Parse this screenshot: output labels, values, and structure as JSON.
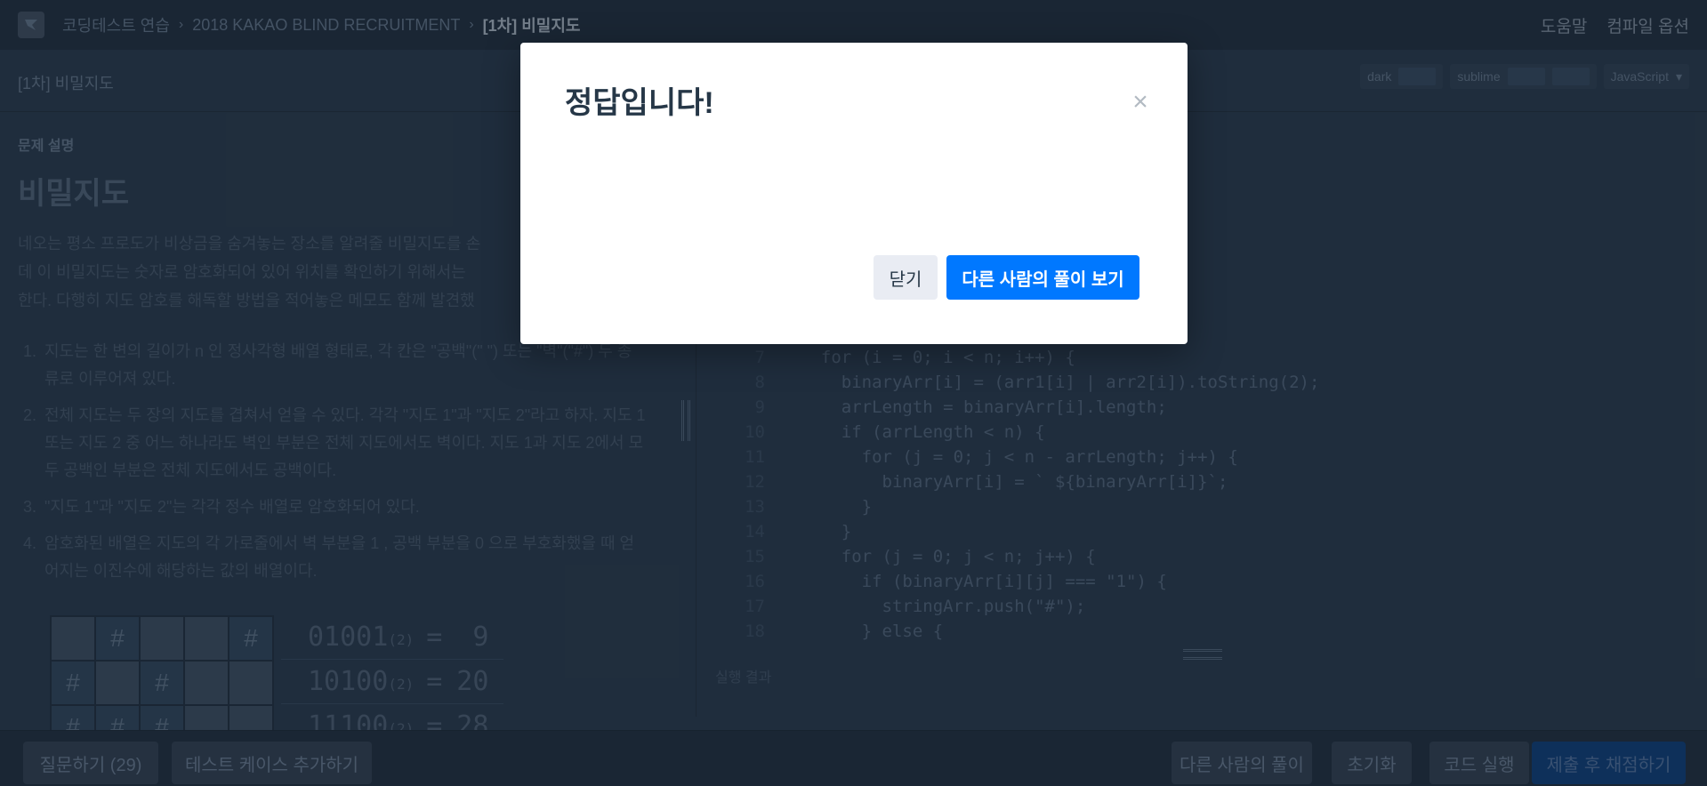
{
  "breadcrumb": {
    "items": [
      "코딩테스트 연습",
      "2018 KAKAO BLIND RECRUITMENT"
    ],
    "current": "[1차] 비밀지도"
  },
  "topnav": {
    "help": "도움말",
    "compile_options": "컴파일 옵션"
  },
  "header": {
    "problem_title": "[1차] 비밀지도",
    "theme_dark": "dark",
    "theme_sublime": "sublime",
    "language": "JavaScript"
  },
  "problem": {
    "section_label": "문제 설명",
    "title": "비밀지도",
    "intro": [
      "네오는 평소 프로도가 비상금을 숨겨놓는 장소를 알려줄 비밀지도를 손",
      "데 이 비밀지도는 숫자로 암호화되어 있어 위치를 확인하기 위해서는",
      "한다. 다행히 지도 암호를 해독할 방법을 적어놓은 메모도 함께 발견했"
    ],
    "rules": [
      "지도는 한 변의 길이가  n  인 정사각형 배열 형태로, 각 칸은 \"공백\"(\" \") 또는 \"벽\"(\"#\") 두 종류로 이루어져 있다.",
      "전체 지도는 두 장의 지도를 겹쳐서 얻을 수 있다. 각각 \"지도 1\"과 \"지도 2\"라고 하자. 지도 1 또는 지도 2 중 어느 하나라도 벽인 부분은 전체 지도에서도 벽이다. 지도 1과 지도 2에서 모두 공백인 부분은 전체 지도에서도 공백이다.",
      "\"지도 1\"과 \"지도 2\"는 각각 정수 배열로 암호화되어 있다.",
      "암호화된 배열은 지도의 각 가로줄에서 벽 부분을  1 , 공백 부분을  0 으로 부호화했을 때 얻어지는 이진수에 해당하는 값의 배열이다."
    ],
    "grid": [
      [
        "",
        "#",
        "",
        "",
        "#"
      ],
      [
        "#",
        "",
        "#",
        "",
        ""
      ],
      [
        "#",
        "#",
        "#",
        "",
        ""
      ]
    ],
    "binary_rows": [
      {
        "bin": "01001",
        "base": "(2)",
        "eq": "=",
        "dec": " 9"
      },
      {
        "bin": "10100",
        "base": "(2)",
        "eq": "=",
        "dec": "20"
      },
      {
        "bin": "11100",
        "base": "(2)",
        "eq": "=",
        "dec": "28"
      }
    ]
  },
  "code": {
    "lines": [
      {
        "n": "7",
        "t": "  for (i = 0; i < n; i++) {"
      },
      {
        "n": "8",
        "t": "    binaryArr[i] = (arr1[i] | arr2[i]).toString(2);"
      },
      {
        "n": "9",
        "t": "    arrLength = binaryArr[i].length;"
      },
      {
        "n": "10",
        "t": "    if (arrLength < n) {"
      },
      {
        "n": "11",
        "t": "      for (j = 0; j < n - arrLength; j++) {"
      },
      {
        "n": "12",
        "t": "        binaryArr[i] = ` ${binaryArr[i]}`;"
      },
      {
        "n": "13",
        "t": "      }"
      },
      {
        "n": "14",
        "t": "    }"
      },
      {
        "n": "15",
        "t": "    for (j = 0; j < n; j++) {"
      },
      {
        "n": "16",
        "t": "      if (binaryArr[i][j] === \"1\") {"
      },
      {
        "n": "17",
        "t": "        stringArr.push(\"#\");"
      },
      {
        "n": "18",
        "t": "      } else {"
      }
    ],
    "run_result_label": "실행 결과"
  },
  "bottombar": {
    "questions": "질문하기 (29)",
    "add_testcase": "테스트 케이스 추가하기",
    "others_solutions": "다른 사람의 풀이",
    "reset": "초기화",
    "run": "코드 실행",
    "submit": "제출 후 채점하기"
  },
  "modal": {
    "title": "정답입니다!",
    "close_x": "×",
    "close_button": "닫기",
    "view_others_button": "다른 사람의 풀이 보기"
  },
  "colors": {
    "primary": "#0078ff",
    "background": "#263747",
    "navbar": "#1e2b39"
  }
}
